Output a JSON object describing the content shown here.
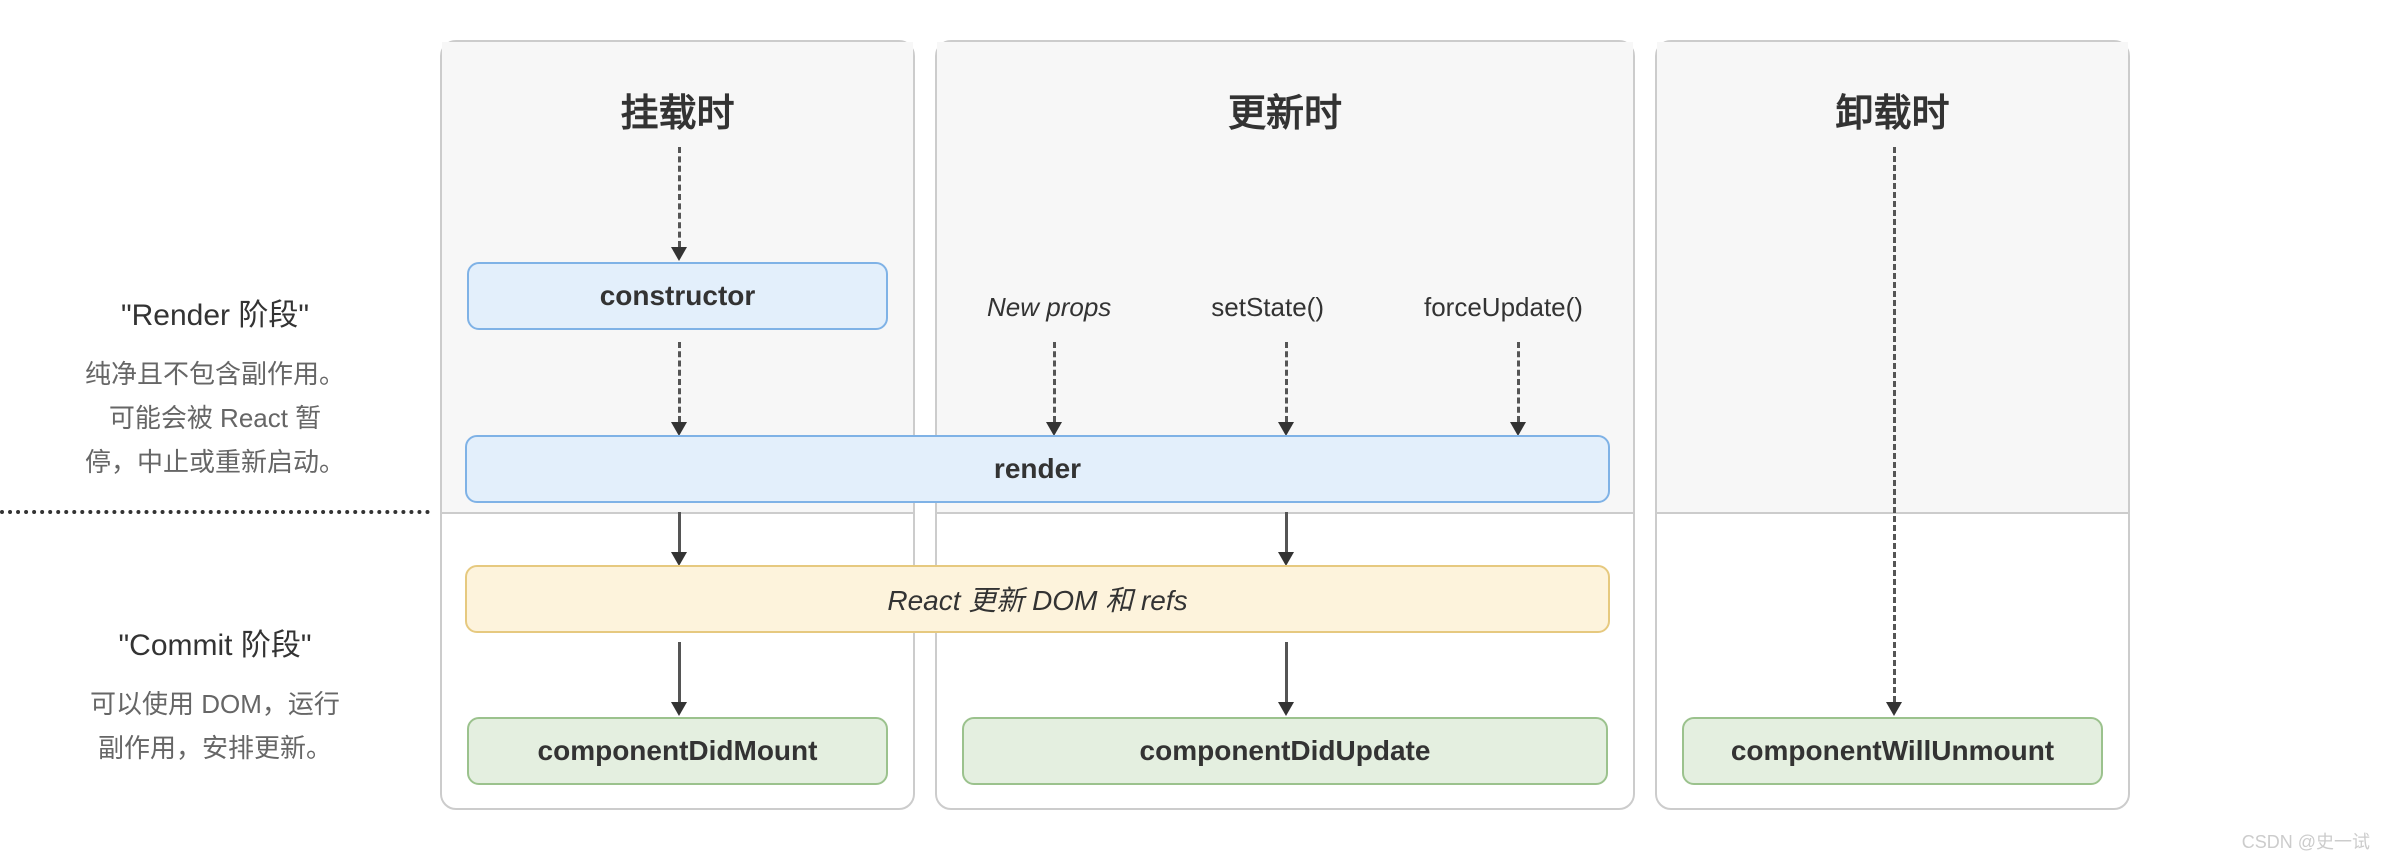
{
  "sidebar": {
    "render": {
      "title": "\"Render 阶段\"",
      "desc1": "纯净且不包含副作用。",
      "desc2": "可能会被 React 暂",
      "desc3": "停，中止或重新启动。"
    },
    "commit": {
      "title": "\"Commit 阶段\"",
      "desc1": "可以使用 DOM，运行",
      "desc2": "副作用，安排更新。"
    }
  },
  "columns": {
    "mount": {
      "title": "挂载时"
    },
    "update": {
      "title": "更新时"
    },
    "unmount": {
      "title": "卸载时"
    }
  },
  "nodes": {
    "constructor": "constructor",
    "render": "render",
    "reactUpdates": "React 更新 DOM 和 refs",
    "didMount": "componentDidMount",
    "didUpdate": "componentDidUpdate",
    "willUnmount": "componentWillUnmount"
  },
  "triggers": {
    "newProps": "New props",
    "setState": "setState()",
    "forceUpdate": "forceUpdate()"
  },
  "watermark": "CSDN @史一试"
}
